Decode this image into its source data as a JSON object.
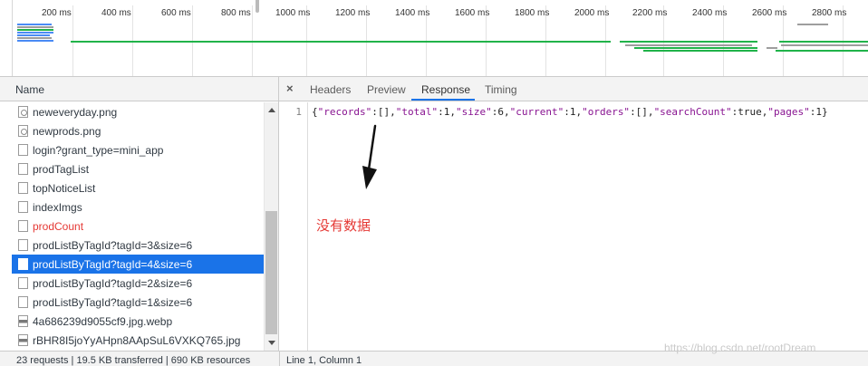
{
  "overview": {
    "ticks": [
      "200 ms",
      "400 ms",
      "600 ms",
      "800 ms",
      "1000 ms",
      "1200 ms",
      "1400 ms",
      "1600 ms",
      "1800 ms",
      "2000 ms",
      "2200 ms",
      "2400 ms",
      "2600 ms",
      "2800 ms"
    ],
    "colors": {
      "green": "#21b34a",
      "blue": "#4a8bf5",
      "gray": "#9e9e9e"
    }
  },
  "list": {
    "header": "Name",
    "rows": [
      {
        "label": "neweveryday.png",
        "icon": "image-file-icon",
        "state": "normal"
      },
      {
        "label": "newprods.png",
        "icon": "image-file-icon",
        "state": "normal"
      },
      {
        "label": "login?grant_type=mini_app",
        "icon": "document-icon",
        "state": "normal"
      },
      {
        "label": "prodTagList",
        "icon": "document-icon",
        "state": "normal"
      },
      {
        "label": "topNoticeList",
        "icon": "document-icon",
        "state": "normal"
      },
      {
        "label": "indexImgs",
        "icon": "document-icon",
        "state": "normal"
      },
      {
        "label": "prodCount",
        "icon": "document-icon",
        "state": "error"
      },
      {
        "label": "prodListByTagId?tagId=3&size=6",
        "icon": "document-icon",
        "state": "normal"
      },
      {
        "label": "prodListByTagId?tagId=4&size=6",
        "icon": "document-icon",
        "state": "selected"
      },
      {
        "label": "prodListByTagId?tagId=2&size=6",
        "icon": "document-icon",
        "state": "normal"
      },
      {
        "label": "prodListByTagId?tagId=1&size=6",
        "icon": "document-icon",
        "state": "normal"
      },
      {
        "label": "4a686239d9055cf9.jpg.webp",
        "icon": "picture-icon",
        "state": "normal"
      },
      {
        "label": "rBHR8I5joYyAHpn8AApSuL6VXKQ765.jpg",
        "icon": "picture-icon",
        "state": "normal"
      }
    ],
    "selected_color": "#1a73e8",
    "error_color": "#e53935"
  },
  "detail": {
    "close_label": "×",
    "tabs": [
      {
        "label": "Headers",
        "active": false
      },
      {
        "label": "Preview",
        "active": false
      },
      {
        "label": "Response",
        "active": true
      },
      {
        "label": "Timing",
        "active": false
      }
    ],
    "line_number": "1",
    "response_text": "{\"records\":[],\"total\":1,\"size\":6,\"current\":1,\"orders\":[],\"searchCount\":true,\"pages\":1}",
    "annotation": "没有数据"
  },
  "status": {
    "summary": "23 requests | 19.5 KB transferred | 690 KB resources",
    "position": "Line 1, Column 1"
  },
  "watermark": "https://blog.csdn.net/rootDream"
}
